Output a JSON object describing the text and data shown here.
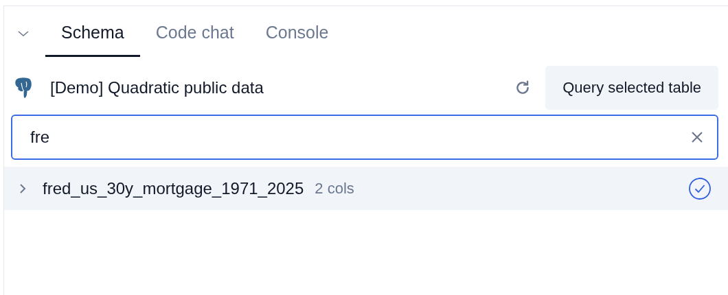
{
  "tabs": [
    {
      "label": "Schema",
      "selected": true
    },
    {
      "label": "Code chat",
      "selected": false
    },
    {
      "label": "Console",
      "selected": false
    }
  ],
  "connection": {
    "name": "[Demo] Quadratic public data",
    "button": "Query selected table"
  },
  "search": {
    "value": "fre"
  },
  "tables": [
    {
      "name": "fred_us_30y_mortgage_1971_2025",
      "cols": "2 cols",
      "selected": true,
      "expanded": false
    }
  ]
}
